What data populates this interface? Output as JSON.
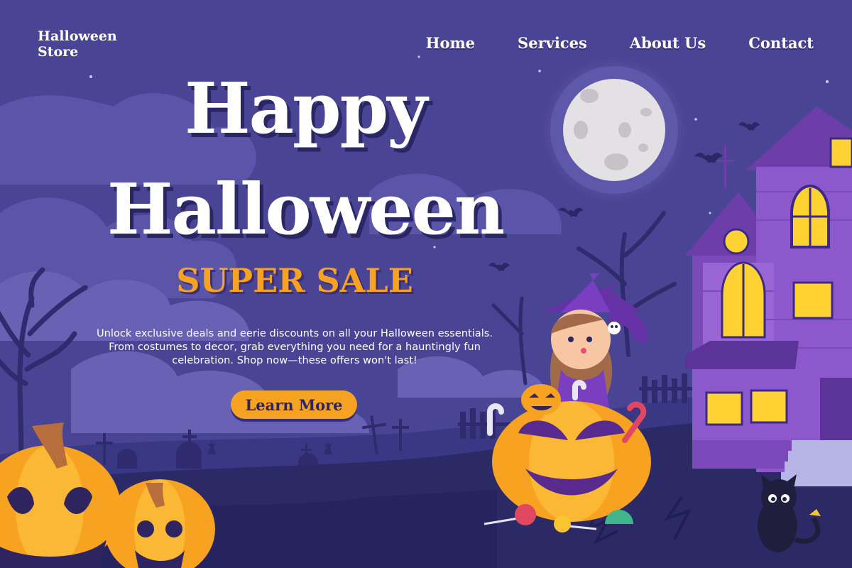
{
  "brand": {
    "line1": "Halloween",
    "line2": "Store"
  },
  "nav": {
    "items": [
      "Home",
      "Services",
      "About Us",
      "Contact"
    ]
  },
  "hero": {
    "title_line1": "Happy",
    "title_line2": "Halloween",
    "subtitle": "SUPER SALE",
    "description": "Unlock exclusive deals and eerie discounts on all your Halloween essentials. From costumes to decor, grab everything you need for a hauntingly fun celebration. Shop now—these offers won't last!",
    "cta_label": "Learn More"
  },
  "colors": {
    "sky": "#4a4494",
    "accent": "#f7a321",
    "house": "#8b55c9",
    "window_glow": "#ffd233",
    "ground": "#2b2a66"
  },
  "icons": [
    "moon-icon",
    "bat-icon",
    "haunted-house-illustration",
    "witch-girl-illustration",
    "jack-o-lantern-icon",
    "black-cat-icon",
    "tombstone-icon",
    "candy-cane-icon",
    "lollipop-icon"
  ]
}
